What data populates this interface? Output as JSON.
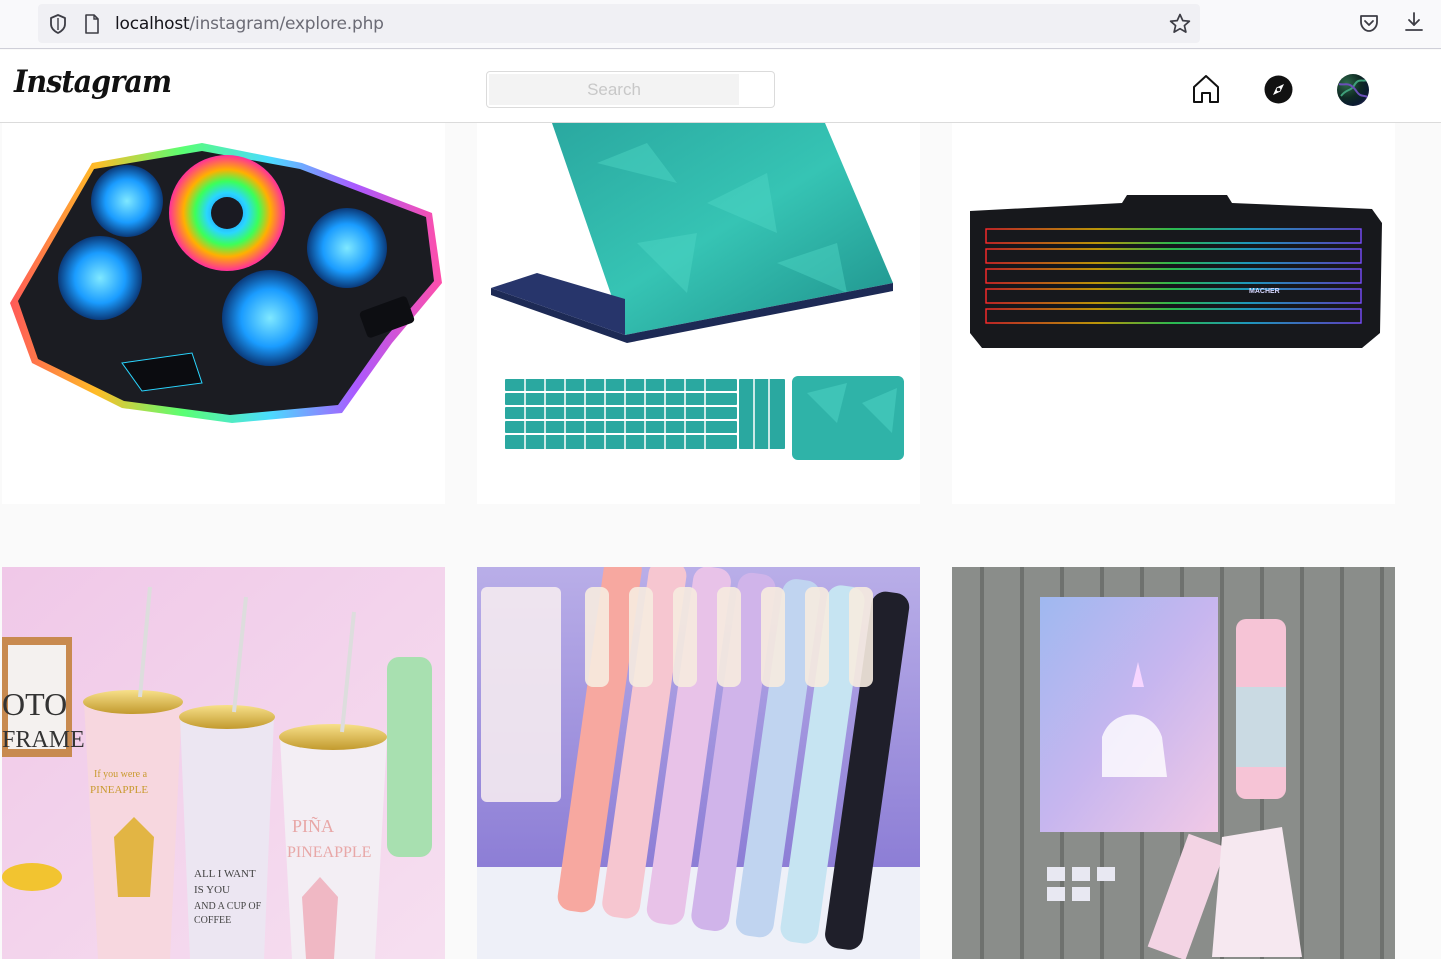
{
  "browser": {
    "url_host": "localhost",
    "url_path": "/instagram/explore.php",
    "icons": [
      "shield-icon",
      "page-icon",
      "bookmark-star-icon",
      "pocket-icon",
      "download-icon"
    ]
  },
  "header": {
    "logo_text": "Instagram",
    "search_placeholder": "Search",
    "nav_icons": [
      "home-icon",
      "explore-compass-icon",
      "profile-avatar"
    ]
  },
  "explore_posts": [
    {
      "subject": "rgb laptop cooling pad"
    },
    {
      "subject": "teal laptop skin and keyboard stickers"
    },
    {
      "subject": "rgb gaming keyboard",
      "brand_text": "MACHER"
    },
    {
      "subject": "pineapple tumblers with straws",
      "printed_text": [
        "If you were a",
        "PINEAPPLE",
        "ALL I WANT",
        "IS YOU",
        "AND A CUP OF",
        "COFFEE",
        "PIÑA",
        "PINEAPPLE"
      ],
      "frame_text": [
        "OTO",
        "FRAME"
      ]
    },
    {
      "subject": "cartoon fountain pens"
    },
    {
      "subject": "unicorn notebook gift set"
    }
  ],
  "colors": {
    "page_bg": "#fafafa",
    "header_bg": "#ffffff",
    "border": "#dbdbdb"
  }
}
